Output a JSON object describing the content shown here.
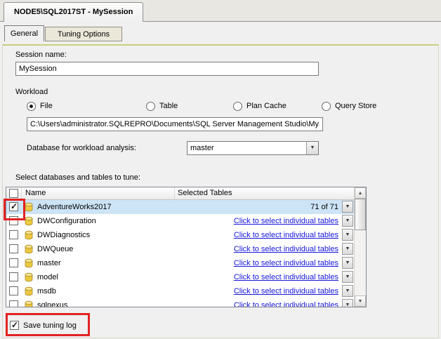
{
  "window": {
    "tab_title": "NODE5\\SQL2017ST - MySession"
  },
  "tabs": [
    {
      "label": "General",
      "active": true
    },
    {
      "label": "Tuning Options",
      "active": false
    }
  ],
  "session": {
    "label": "Session name:",
    "value": "MySession"
  },
  "workload": {
    "label": "Workload",
    "options": [
      {
        "label": "File",
        "selected": true
      },
      {
        "label": "Table",
        "selected": false
      },
      {
        "label": "Plan Cache",
        "selected": false
      },
      {
        "label": "Query Store",
        "selected": false
      }
    ],
    "file_path": "C:\\Users\\administrator.SQLREPRO\\Documents\\SQL Server Management Studio\\MyScript.sql",
    "database_label": "Database for workload analysis:",
    "database_value": "master"
  },
  "tables_section": {
    "label": "Select databases and tables to tune:",
    "columns": {
      "name": "Name",
      "selected_tables": "Selected Tables"
    },
    "rows": [
      {
        "name": "AdventureWorks2017",
        "checked": true,
        "highlighted": true,
        "selected_tables": "71 of 71",
        "is_link": false
      },
      {
        "name": "DWConfiguration",
        "checked": false,
        "highlighted": false,
        "selected_tables": "Click to select individual tables",
        "is_link": true
      },
      {
        "name": "DWDiagnostics",
        "checked": false,
        "highlighted": false,
        "selected_tables": "Click to select individual tables",
        "is_link": true
      },
      {
        "name": "DWQueue",
        "checked": false,
        "highlighted": false,
        "selected_tables": "Click to select individual tables",
        "is_link": true
      },
      {
        "name": "master",
        "checked": false,
        "highlighted": false,
        "selected_tables": "Click to select individual tables",
        "is_link": true
      },
      {
        "name": "model",
        "checked": false,
        "highlighted": false,
        "selected_tables": "Click to select individual tables",
        "is_link": true
      },
      {
        "name": "msdb",
        "checked": false,
        "highlighted": false,
        "selected_tables": "Click to select individual tables",
        "is_link": true
      },
      {
        "name": "sqlnexus",
        "checked": false,
        "highlighted": false,
        "selected_tables": "Click to select individual tables",
        "is_link": true
      }
    ]
  },
  "footer": {
    "save_tuning_log_label": "Save tuning log",
    "checked": true
  },
  "colors": {
    "link": "#1515dd",
    "selected_row": "#cde4f7",
    "annotation_red": "#e32222",
    "tab_underline": "#cbcf7a",
    "database_icon": "#f0d34a"
  }
}
